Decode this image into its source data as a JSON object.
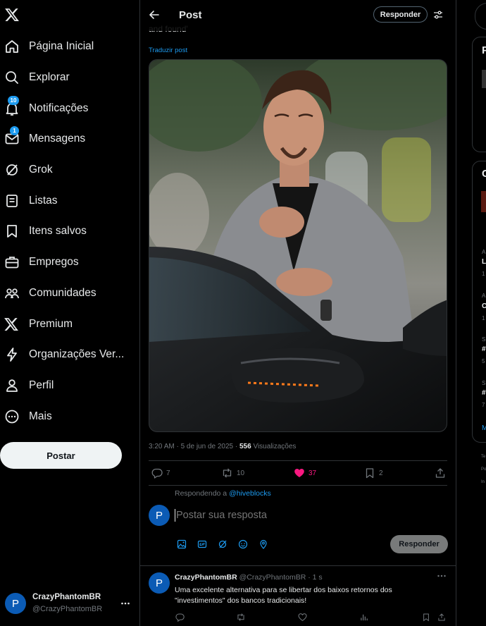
{
  "sidebar": {
    "items": [
      {
        "label": "Página Inicial",
        "icon": "home-icon"
      },
      {
        "label": "Explorar",
        "icon": "search-icon"
      },
      {
        "label": "Notificações",
        "icon": "bell-icon",
        "badge": "10"
      },
      {
        "label": "Mensagens",
        "icon": "mail-icon",
        "badge": "1"
      },
      {
        "label": "Grok",
        "icon": "grok-icon"
      },
      {
        "label": "Listas",
        "icon": "list-icon"
      },
      {
        "label": "Itens salvos",
        "icon": "bookmark-icon"
      },
      {
        "label": "Empregos",
        "icon": "briefcase-icon"
      },
      {
        "label": "Comunidades",
        "icon": "people-icon"
      },
      {
        "label": "Premium",
        "icon": "x-logo-icon"
      },
      {
        "label": "Organizações Ver...",
        "icon": "lightning-icon"
      },
      {
        "label": "Perfil",
        "icon": "person-icon"
      },
      {
        "label": "Mais",
        "icon": "more-circle-icon"
      }
    ],
    "post_button": "Postar",
    "account": {
      "avatar_letter": "P",
      "name": "CrazyPhantomBR",
      "handle": "@CrazyPhantomBR"
    }
  },
  "header": {
    "title": "Post",
    "reply_button": "Responder"
  },
  "post": {
    "text_tail": "and found'",
    "translate": "Traduzir post",
    "time": "3:20 AM · 5 de jun de 2025 · ",
    "views_count": "556",
    "views_label": " Visualizações",
    "actions": {
      "replies": "7",
      "reposts": "10",
      "likes": "37",
      "bookmarks": "2"
    }
  },
  "composer": {
    "replying_to_prefix": "Respondendo a ",
    "replying_to_handle": "@hiveblocks",
    "avatar_letter": "P",
    "placeholder": "Postar sua resposta",
    "submit": "Responder"
  },
  "reply": {
    "avatar_letter": "P",
    "name": "CrazyPhantomBR",
    "handle": "@CrazyPhantomBR",
    "time": " · 1 s",
    "text": "Uma excelente alternativa para se libertar dos baixos retornos dos \"investimentos\" dos bancos tradicionais!"
  },
  "right": {
    "fragments": [
      "P",
      "C",
      "A",
      "L",
      "1",
      "A",
      "C",
      "1",
      "S",
      "#",
      "5",
      "S",
      "#",
      "7",
      "M",
      "Te",
      "Po",
      "In"
    ]
  },
  "colors": {
    "accent": "#1d9bf0",
    "like": "#f91880",
    "background": "#000000",
    "border": "#2f3336"
  }
}
